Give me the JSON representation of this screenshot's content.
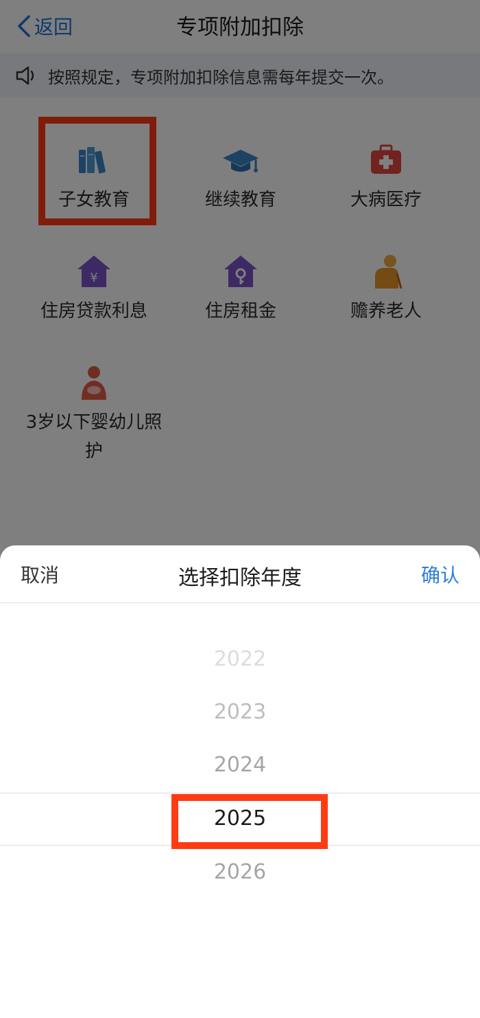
{
  "navbar": {
    "back_label": "返回",
    "title": "专项附加扣除"
  },
  "notice": {
    "text": "按照规定，专项附加扣除信息需每年提交一次。"
  },
  "categories": [
    {
      "label": "子女教育",
      "icon": "books-icon"
    },
    {
      "label": "继续教育",
      "icon": "graduation-cap-icon"
    },
    {
      "label": "大病医疗",
      "icon": "medical-kit-icon"
    },
    {
      "label": "住房贷款利息",
      "icon": "house-yuan-icon"
    },
    {
      "label": "住房租金",
      "icon": "house-key-icon"
    },
    {
      "label": "赡养老人",
      "icon": "elderly-person-icon"
    },
    {
      "label": "3岁以下婴幼儿照护",
      "icon": "mother-baby-icon"
    }
  ],
  "sheet": {
    "cancel_label": "取消",
    "title": "选择扣除年度",
    "confirm_label": "确认",
    "years": [
      "2022",
      "2023",
      "2024",
      "2025",
      "2026"
    ],
    "selected_year": "2025"
  },
  "colors": {
    "accent": "#2b7fd8",
    "highlight": "#ff3b14"
  }
}
